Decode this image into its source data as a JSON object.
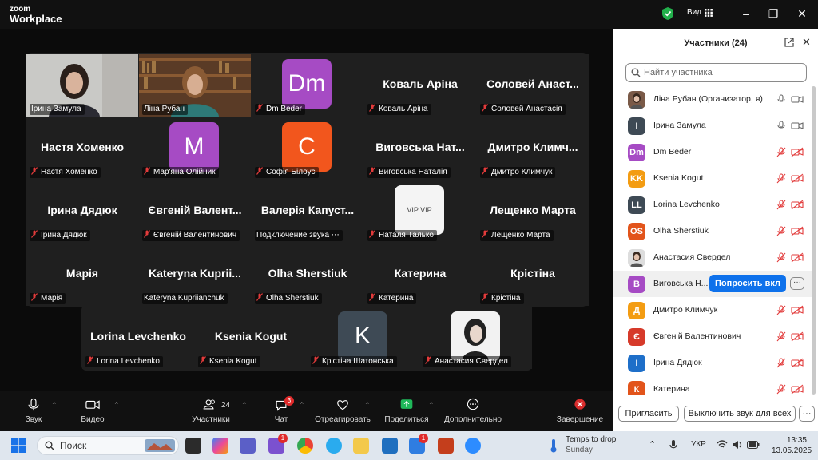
{
  "app": {
    "logo_line1": "zoom",
    "logo_line2": "Workplace",
    "view_label": "Вид"
  },
  "tiles": [
    {
      "name": "Ірина Замула",
      "kind": "video",
      "active": true,
      "muted": false
    },
    {
      "name": "Ліна Рубан",
      "kind": "video",
      "muted": false
    },
    {
      "name": "Dm Beder",
      "kind": "avatar",
      "initials": "Dm",
      "color": "#a64bc4",
      "muted": true
    },
    {
      "name": "Коваль Аріна",
      "kind": "text",
      "big": "Коваль Аріна",
      "muted": true
    },
    {
      "name": "Соловей Анастасія",
      "kind": "text",
      "big": "Соловей Анаст...",
      "muted": true
    },
    {
      "name": "Настя Хоменко",
      "kind": "text",
      "big": "Настя Хоменко",
      "muted": true
    },
    {
      "name": "Мар'яна Олійник",
      "kind": "avatar",
      "initials": "M",
      "color": "#a64bc4",
      "muted": true
    },
    {
      "name": "Софія Білоус",
      "kind": "avatar",
      "initials": "C",
      "color": "#f2561d",
      "muted": true
    },
    {
      "name": "Виговська Наталія",
      "kind": "text",
      "big": "Виговська Нат...",
      "muted": true
    },
    {
      "name": "Дмитро Климчук",
      "kind": "text",
      "big": "Дмитро Климч...",
      "muted": true
    },
    {
      "name": "Ірина Дядюк",
      "kind": "text",
      "big": "Ірина Дядюк",
      "muted": true
    },
    {
      "name": "Євгеній Валентинович",
      "kind": "text",
      "big": "Євгеній Валент...",
      "muted": true
    },
    {
      "name": "Подключение звука",
      "kind": "text",
      "big": "Валерія Капуст...",
      "muted": false,
      "connecting": true
    },
    {
      "name": "Наталя Талько",
      "kind": "logo",
      "logo_text": "VIP VIP",
      "muted": true
    },
    {
      "name": "Лещенко Марта",
      "kind": "text",
      "big": "Лещенко Марта",
      "muted": true
    },
    {
      "name": "Марія",
      "kind": "text",
      "big": "Марія",
      "muted": true
    },
    {
      "name": "Kateryna Kupriianchuk",
      "kind": "text",
      "big": "Kateryna Kuprii...",
      "muted": false
    },
    {
      "name": "Olha Sherstiuk",
      "kind": "text",
      "big": "Olha Sherstiuk",
      "muted": true
    },
    {
      "name": "Катерина",
      "kind": "text",
      "big": "Катерина",
      "muted": true
    },
    {
      "name": "Крістіна",
      "kind": "text",
      "big": "Крістіна",
      "muted": true
    },
    {
      "name": "Lorina Levchenko",
      "kind": "text",
      "big": "Lorina Levchenko",
      "muted": true
    },
    {
      "name": "Ksenia Kogut",
      "kind": "text",
      "big": "Ksenia Kogut",
      "muted": true
    },
    {
      "name": "Крістіна Шатонська",
      "kind": "avatar",
      "initials": "K",
      "color": "#3e4a55",
      "muted": true
    },
    {
      "name": "Анастасия Свердел",
      "kind": "photo",
      "muted": true
    }
  ],
  "toolbar": {
    "audio": "Звук",
    "video": "Видео",
    "participants": "Участники",
    "participants_count": "24",
    "chat": "Чат",
    "chat_badge": "3",
    "react": "Отреагировать",
    "share": "Поделиться",
    "more": "Дополнительно",
    "end": "Завершение"
  },
  "panel": {
    "title": "Участники (24)",
    "search_placeholder": "Найти участника",
    "ask_unmute": "Попросить вкл",
    "invite": "Пригласить",
    "mute_all": "Выключить звук для всех",
    "more": "···"
  },
  "participants": [
    {
      "name": "Ліна Рубан (Организатор, я)",
      "initials": "",
      "color": "#7a5a48",
      "muted": false,
      "photo": true
    },
    {
      "name": "Ірина Замула",
      "initials": "І",
      "color": "#3e4a55",
      "muted": false
    },
    {
      "name": "Dm Beder",
      "initials": "Dm",
      "color": "#a64bc4",
      "muted": true
    },
    {
      "name": "Ksenia Kogut",
      "initials": "KK",
      "color": "#f39c12",
      "muted": true
    },
    {
      "name": "Lorina Levchenko",
      "initials": "LL",
      "color": "#3e4a55",
      "muted": true
    },
    {
      "name": "Olha Sherstiuk",
      "initials": "OS",
      "color": "#e2541b",
      "muted": true
    },
    {
      "name": "Анастасия Свердел",
      "initials": "",
      "color": "#ddd",
      "muted": true,
      "photo": true
    },
    {
      "name": "Виговська Н...",
      "initials": "В",
      "color": "#a64bc4",
      "muted": true,
      "highlight": true
    },
    {
      "name": "Дмитро Климчук",
      "initials": "Д",
      "color": "#f39c12",
      "muted": true
    },
    {
      "name": "Євгеній Валентинович",
      "initials": "Є",
      "color": "#d63a2a",
      "muted": true
    },
    {
      "name": "Ірина Дядюк",
      "initials": "І",
      "color": "#1e6fc9",
      "muted": true
    },
    {
      "name": "Катерина",
      "initials": "К",
      "color": "#e2541b",
      "muted": true
    }
  ],
  "taskbar": {
    "search": "Поиск",
    "weather_line1": "Temps to drop",
    "weather_line2": "Sunday",
    "lang": "УКР",
    "time": "13:35",
    "date": "13.05.2025",
    "teams_badge": "1",
    "viber_badge": "1"
  }
}
